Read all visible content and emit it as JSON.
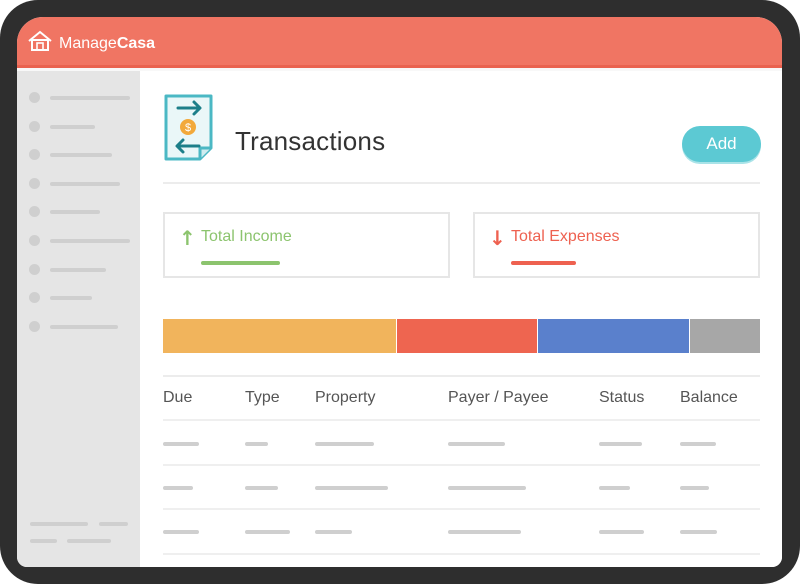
{
  "app": {
    "brand_light": "Manage",
    "brand_bold": "Casa"
  },
  "page": {
    "title": "Transactions",
    "add_label": "Add"
  },
  "summary": {
    "income": {
      "label": "Total Income",
      "color": "#8cc46e"
    },
    "expenses": {
      "label": "Total Expenses",
      "color": "#ee6150"
    }
  },
  "breakdown_bar": [
    {
      "color": "#f1b45c",
      "fraction": 0.392
    },
    {
      "color": "#ee6550",
      "fraction": 0.236
    },
    {
      "color": "#5a80cc",
      "fraction": 0.255
    },
    {
      "color": "#a7a7a7",
      "fraction": 0.117
    }
  ],
  "table": {
    "columns": [
      "Due",
      "Type",
      "Property",
      "Payer / Payee",
      "Status",
      "Balance"
    ]
  },
  "colors": {
    "header": "#f07563",
    "accent": "#5cc9d3",
    "sidebar": "#e5e5e5"
  }
}
